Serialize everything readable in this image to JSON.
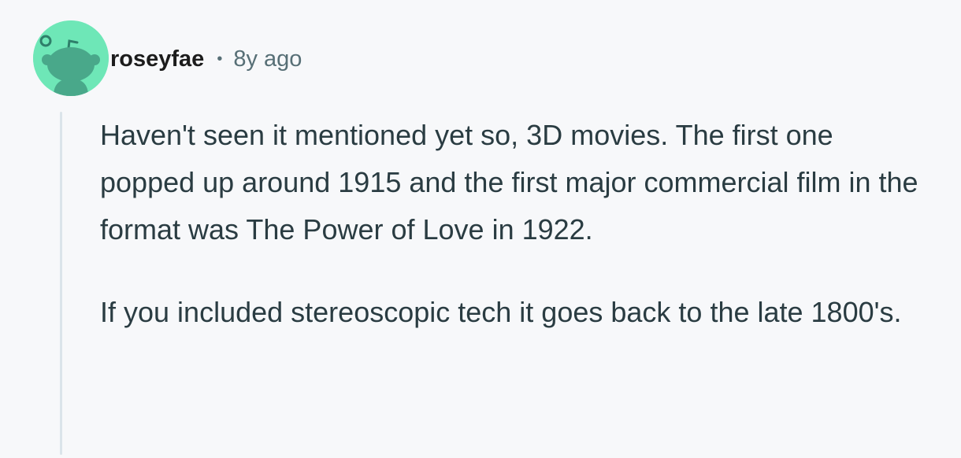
{
  "comment": {
    "author": "roseyfae",
    "separator": "•",
    "timestamp": "8y ago",
    "avatar_icon": "reddit-snoo-avatar-icon",
    "avatar_color": "#6ee7b7",
    "paragraphs": [
      "Haven't seen it mentioned yet so, 3D movies. The first one popped up around 1915 and the first major commercial film in the format was The Power of Love in 1922.",
      "If you included stereoscopic tech it goes back to the late 1800's."
    ]
  }
}
